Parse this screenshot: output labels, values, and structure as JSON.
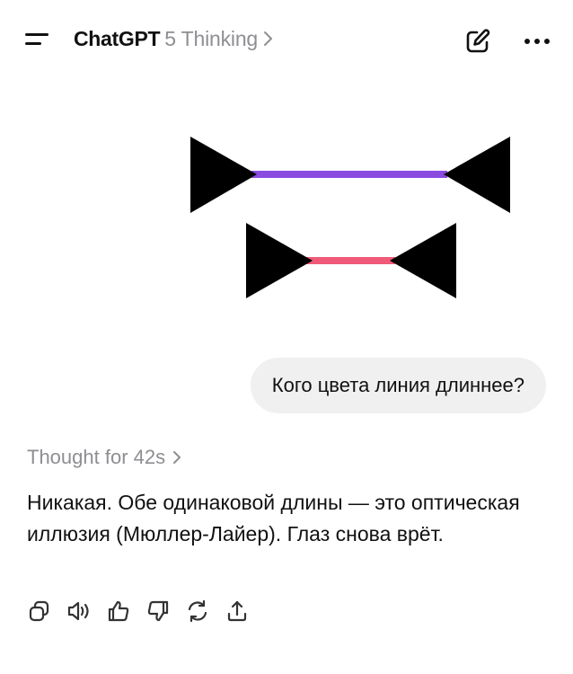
{
  "header": {
    "app_title": "ChatGPT",
    "model_name": "5 Thinking",
    "menu_icon": "menu-icon",
    "new_chat_icon": "compose-icon",
    "more_icon": "more-dots-icon"
  },
  "conversation": {
    "image": {
      "description_icon": "muller-lyer-illusion-image",
      "top_line_color": "#8a4be0",
      "bottom_line_color": "#f05a78",
      "arrow_color": "#000000"
    },
    "user_message": "Кого цвета линия длиннее?",
    "thought_label": "Thought for 42s",
    "assistant_message": "Никакая. Обе одинаковой длины — это оптическая иллюзия (Мюллер-Лайер). Глаз снова врёт."
  },
  "actions": [
    {
      "name": "copy",
      "icon": "copy-icon"
    },
    {
      "name": "read-aloud",
      "icon": "speaker-icon"
    },
    {
      "name": "good-response",
      "icon": "thumbs-up-icon"
    },
    {
      "name": "bad-response",
      "icon": "thumbs-down-icon"
    },
    {
      "name": "regenerate",
      "icon": "refresh-icon"
    },
    {
      "name": "share",
      "icon": "share-icon"
    }
  ]
}
